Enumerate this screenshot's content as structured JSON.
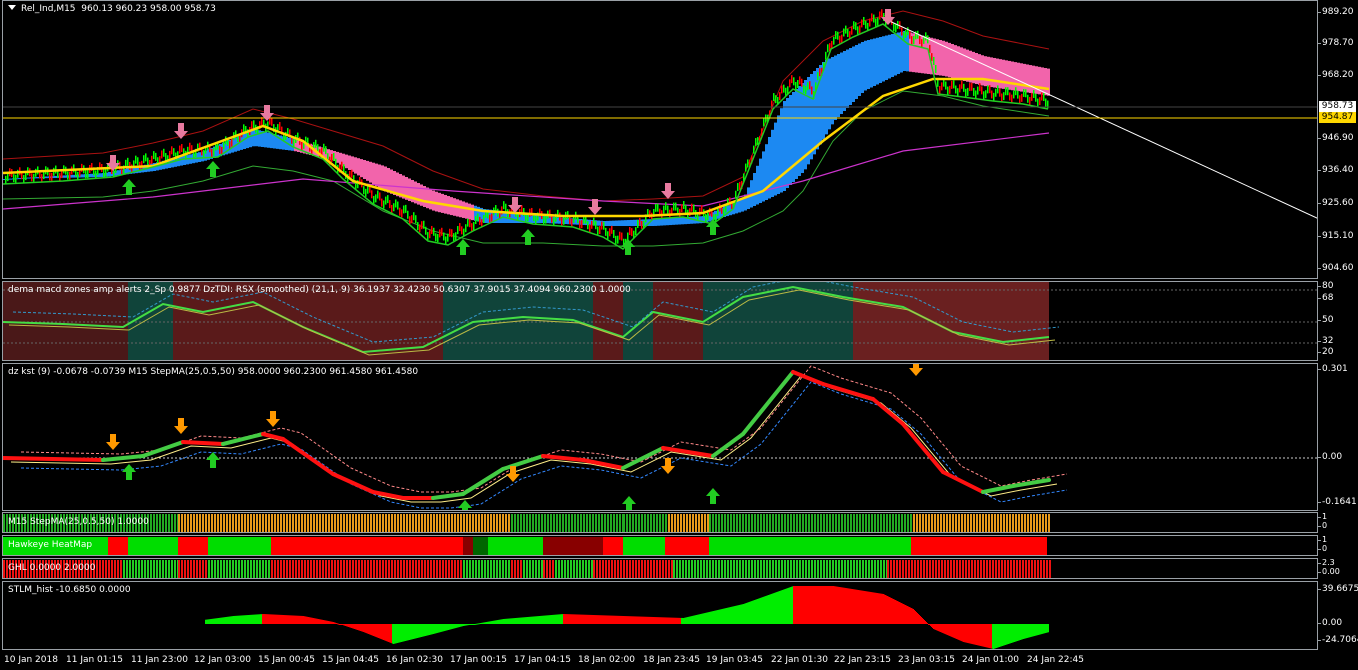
{
  "main_chart": {
    "title": "Rel_Ind,M15",
    "ohlc": "960.13 960.23 958.00 958.73",
    "price_scale": [
      "989.20",
      "978.70",
      "968.20",
      "958.73",
      "954.87",
      "946.90",
      "936.40",
      "925.60",
      "915.10",
      "904.60"
    ],
    "current_price": "958.73",
    "line_price": "954.87",
    "colors": {
      "bull": "#00ff00",
      "bear": "#ff0000",
      "cloud_up": "#1e90ff",
      "cloud_down": "#ff69b4",
      "ma_fast": "#ffd700",
      "ma_slow": "#cc33cc",
      "arrow_up": "#22cc22",
      "arrow_down": "#e87aa0"
    }
  },
  "rsx_pane": {
    "label": "dema macd zones amp alerts 2_Sp  0.9877  DzTDI:  RSX (smoothed) (21,1, 9) 36.1937 32.4230 50.6307 37.9015 37.4094 960.2300 1.0000",
    "scale": [
      "80",
      "76",
      "68",
      "50",
      "32",
      "24",
      "20"
    ]
  },
  "kst_pane": {
    "label": "dz kst (9) -0.0678 -0.0739  M15 StepMA(25,0.5,50) 958.0000 960.2300 961.4580 961.4580",
    "scale": [
      "0.301",
      "0.00",
      "0.00",
      "-0.1641"
    ]
  },
  "stepma_pane": {
    "label": "M15 StepMA(25,0.5,50) 1.0000",
    "scale": [
      "1",
      "0"
    ]
  },
  "heatmap_pane": {
    "label": "Hawkeye HeatMap",
    "scale": [
      "1",
      "0"
    ]
  },
  "ghl_pane": {
    "label": "GHL 0.0000 2.0000",
    "scale": [
      "2.3",
      "0.00"
    ]
  },
  "stlm_pane": {
    "label": "STLM_hist -10.6850 0.0000",
    "scale": [
      "39.6675",
      "0.00",
      "-24.7064"
    ]
  },
  "time_axis": [
    "10 Jan 2018",
    "11 Jan 01:15",
    "11 Jan 23:00",
    "12 Jan 03:00",
    "15 Jan 00:45",
    "15 Jan 04:45",
    "16 Jan 02:30",
    "17 Jan 00:15",
    "17 Jan 04:15",
    "18 Jan 02:00",
    "18 Jan 23:45",
    "19 Jan 03:45",
    "22 Jan 01:30",
    "22 Jan 23:15",
    "23 Jan 03:15",
    "24 Jan 01:00",
    "24 Jan 22:45"
  ]
}
